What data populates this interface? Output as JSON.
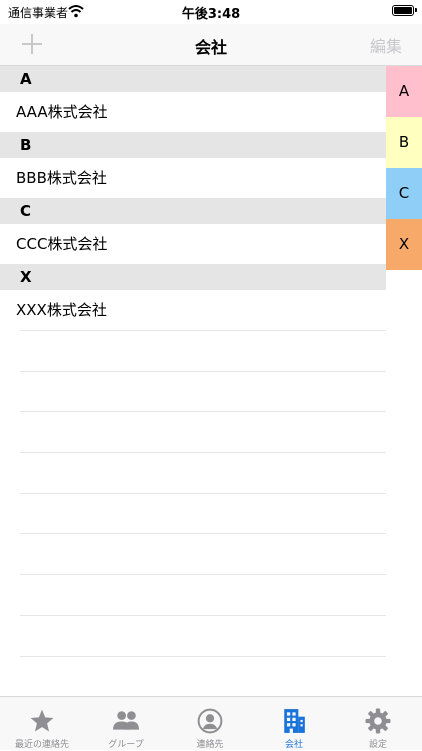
{
  "status_bar": {
    "carrier": "通信事業者",
    "time": "午後3:48"
  },
  "nav": {
    "title": "会社",
    "edit_label": "編集"
  },
  "sections": [
    {
      "header": "A",
      "company": "AAA株式会社"
    },
    {
      "header": "B",
      "company": "BBB株式会社"
    },
    {
      "header": "C",
      "company": "CCC株式会社"
    },
    {
      "header": "X",
      "company": "XXX株式会社"
    }
  ],
  "index_tabs": [
    {
      "label": "A",
      "color": "#ffbfcc"
    },
    {
      "label": "B",
      "color": "#ffffbf"
    },
    {
      "label": "C",
      "color": "#8fcff7"
    },
    {
      "label": "X",
      "color": "#f6a968"
    }
  ],
  "tab_bar": {
    "items": [
      {
        "label": "最近の連絡先",
        "icon": "star-icon"
      },
      {
        "label": "グループ",
        "icon": "people-icon"
      },
      {
        "label": "連絡先",
        "icon": "contact-icon"
      },
      {
        "label": "会社",
        "icon": "building-icon"
      },
      {
        "label": "設定",
        "icon": "gear-icon"
      }
    ],
    "active_index": 3,
    "active_color": "#1a73d9",
    "inactive_color": "#8e8e93"
  }
}
